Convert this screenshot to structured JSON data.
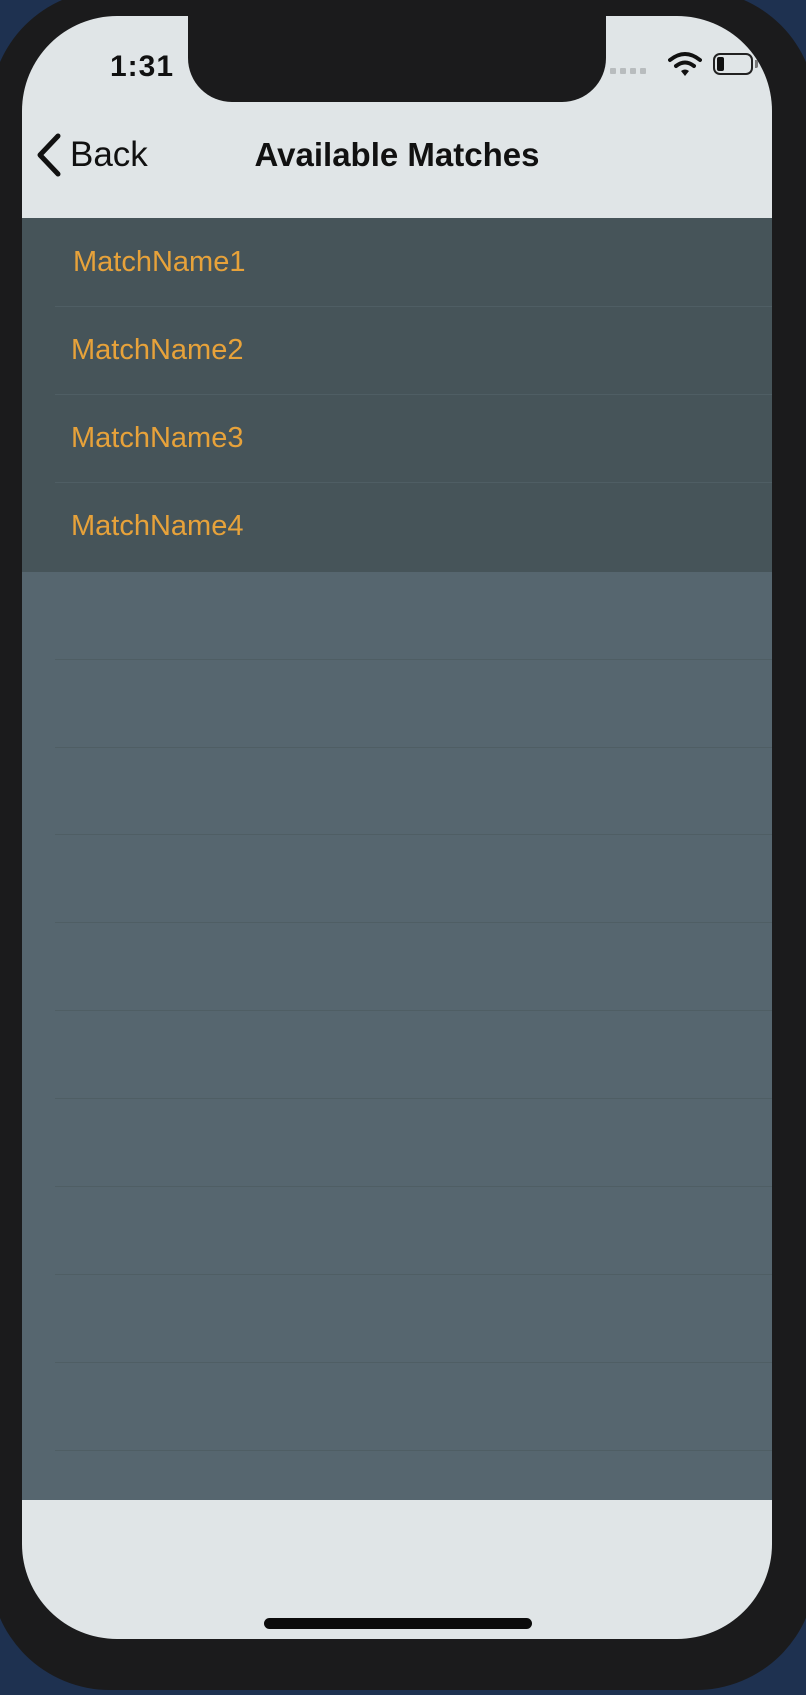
{
  "status_bar": {
    "time": "1:31",
    "icons": [
      "signal-icon",
      "wifi-icon",
      "battery-icon"
    ]
  },
  "nav": {
    "back_label": "Back",
    "title": "Available Matches",
    "back_icon": "chevron-left-icon"
  },
  "matches": [
    {
      "name": "MatchName1"
    },
    {
      "name": "MatchName2"
    },
    {
      "name": "MatchName3"
    },
    {
      "name": "MatchName4"
    }
  ],
  "colors": {
    "match_text": "#e7a23a",
    "row_background": "#465459",
    "table_background": "#56666f",
    "bar_background": "#e0e5e7"
  }
}
